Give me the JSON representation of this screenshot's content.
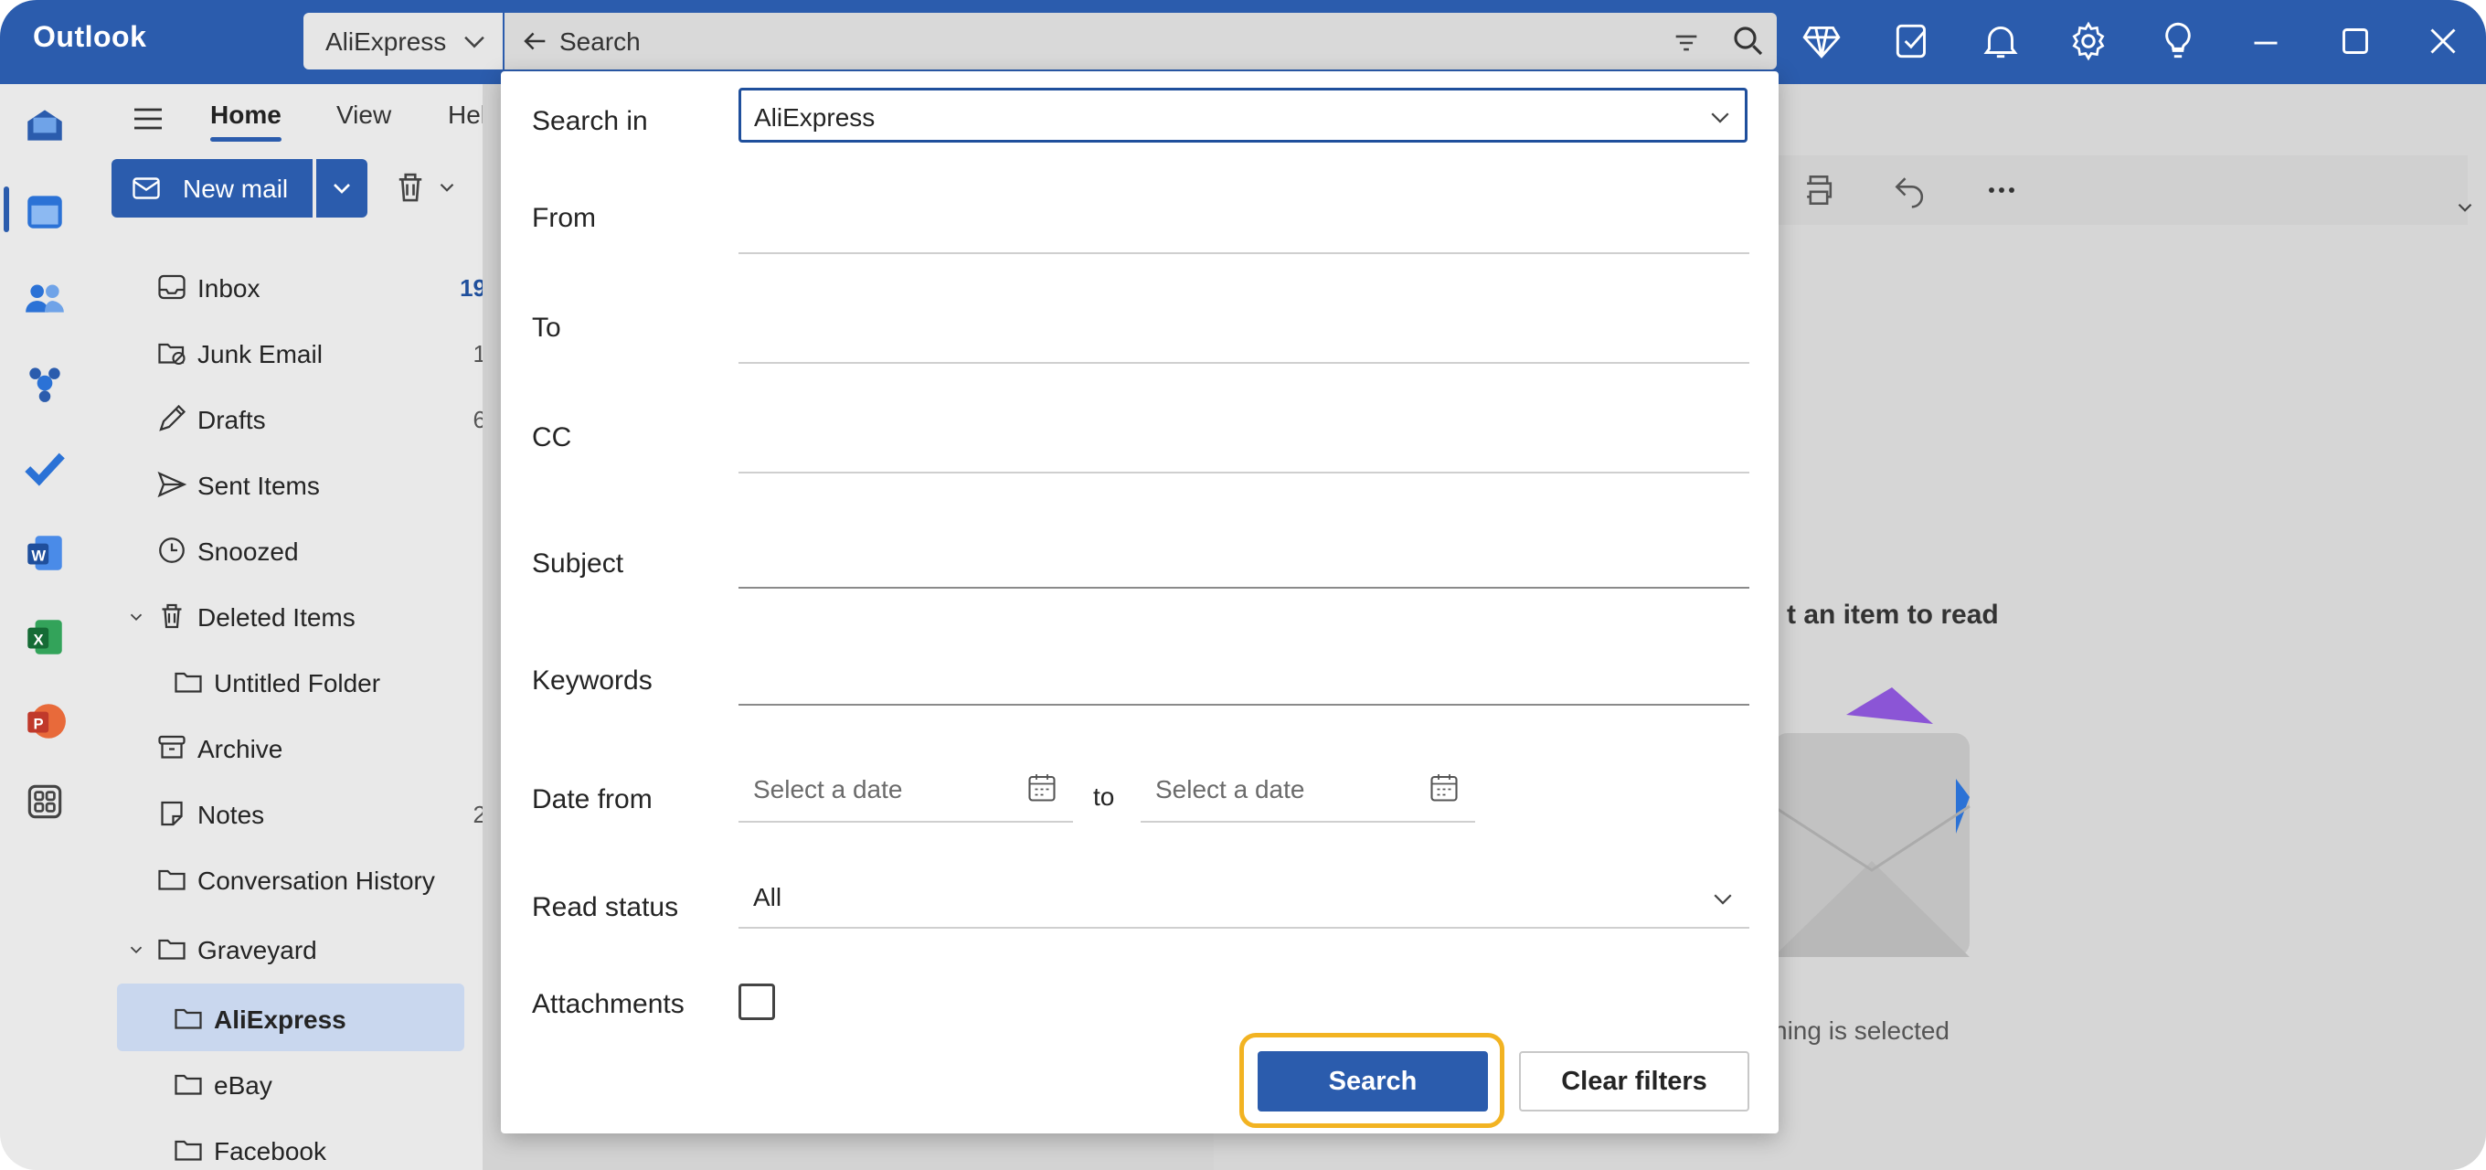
{
  "app": {
    "title": "Outlook"
  },
  "search": {
    "scope": "AliExpress",
    "placeholder": "Search"
  },
  "ribbon": {
    "tabs": [
      "Home",
      "View",
      "Help"
    ],
    "new_mail_label": "New mail"
  },
  "folders": [
    {
      "label": "Inbox",
      "count": "19",
      "icon": "inbox-icon"
    },
    {
      "label": "Junk Email",
      "count": "1",
      "icon": "junk-icon"
    },
    {
      "label": "Drafts",
      "count": "6",
      "icon": "drafts-icon"
    },
    {
      "label": "Sent Items",
      "count": "",
      "icon": "send-icon"
    },
    {
      "label": "Snoozed",
      "count": "",
      "icon": "clock-icon"
    },
    {
      "label": "Deleted Items",
      "count": "",
      "icon": "trash-icon"
    },
    {
      "label": "Untitled Folder",
      "count": "",
      "icon": "folder-icon"
    },
    {
      "label": "Archive",
      "count": "",
      "icon": "archive-icon"
    },
    {
      "label": "Notes",
      "count": "2",
      "icon": "note-icon"
    },
    {
      "label": "Conversation History",
      "count": "",
      "icon": "folder-icon"
    },
    {
      "label": "Graveyard",
      "count": "",
      "icon": "folder-icon"
    },
    {
      "label": "AliExpress",
      "count": "",
      "icon": "folder-icon"
    },
    {
      "label": "eBay",
      "count": "",
      "icon": "folder-icon"
    },
    {
      "label": "Facebook",
      "count": "",
      "icon": "folder-icon"
    }
  ],
  "dialog": {
    "search_in_label": "Search in",
    "search_in_value": "AliExpress",
    "from_label": "From",
    "to_label": "To",
    "cc_label": "CC",
    "subject_label": "Subject",
    "keywords_label": "Keywords",
    "date_from_label": "Date from",
    "date_placeholder": "Select a date",
    "date_to_label": "to",
    "read_status_label": "Read status",
    "read_status_value": "All",
    "attachments_label": "Attachments",
    "search_button": "Search",
    "clear_button": "Clear filters"
  },
  "reading_pane": {
    "title": "t an item to read",
    "subtitle": "hing is selected"
  },
  "colors": {
    "brand": "#2b5cad",
    "highlight": "#f2b322",
    "selected_folder": "#c9d7ee"
  }
}
